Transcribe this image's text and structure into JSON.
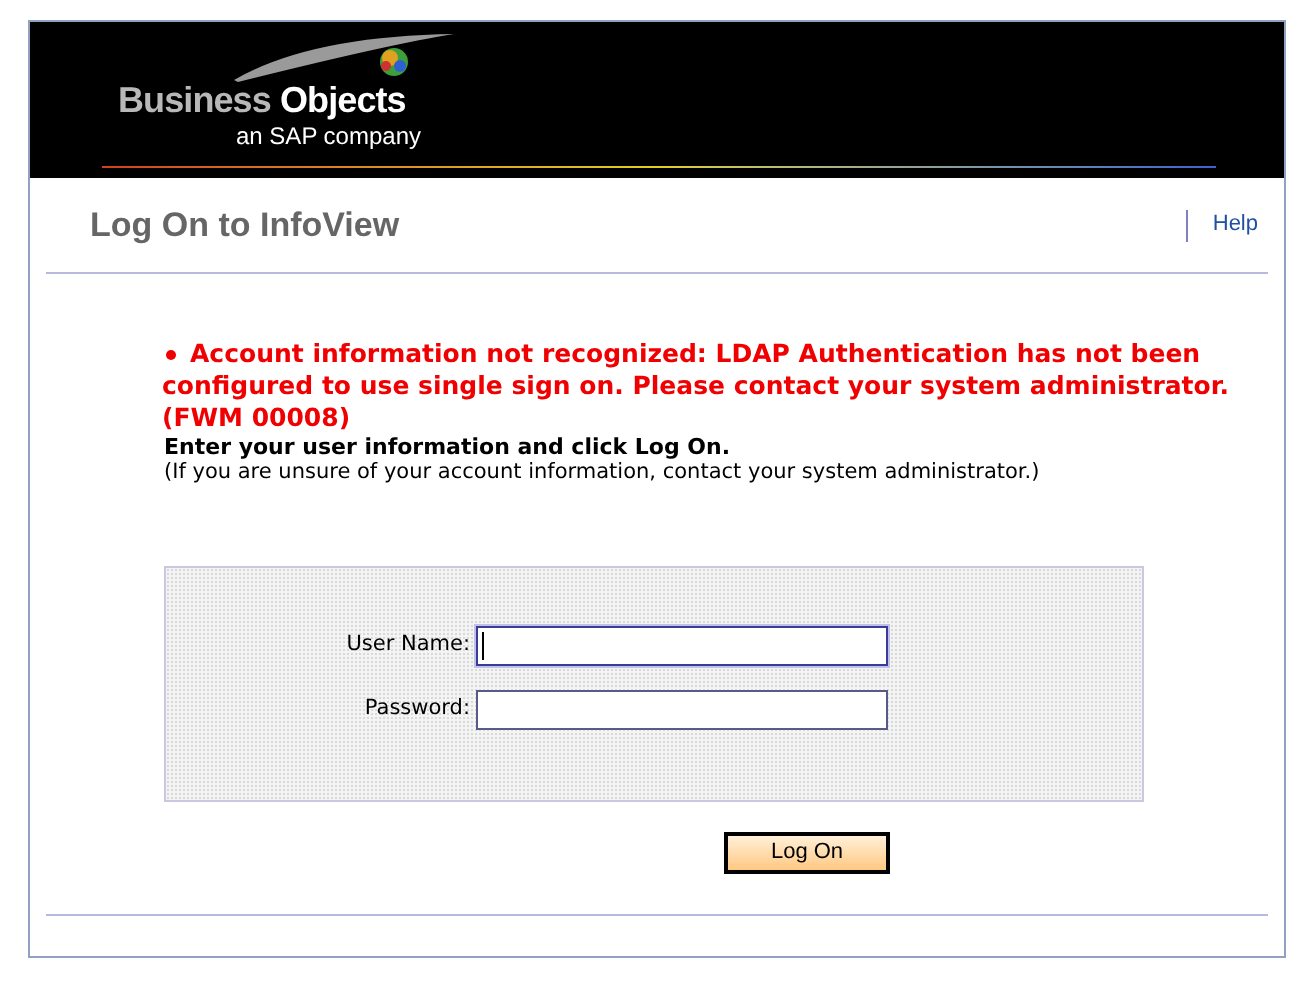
{
  "header": {
    "brand_light": "Business",
    "brand_bold": "Objects",
    "tagline": "an SAP company"
  },
  "title_bar": {
    "title": "Log On to InfoView",
    "help_link": "Help"
  },
  "errors": [
    "Account information not recognized: LDAP Authentication has not been configured to use single sign on. Please contact your system administrator. (FWM 00008)"
  ],
  "instruction": "Enter your user information and click Log On.",
  "hint": "(If you are unsure of your account information, contact your system administrator.)",
  "form": {
    "fields": [
      {
        "label": "User Name:",
        "focused": true
      },
      {
        "label": "Password:",
        "focused": false
      }
    ],
    "submit_button": "Log On"
  }
}
